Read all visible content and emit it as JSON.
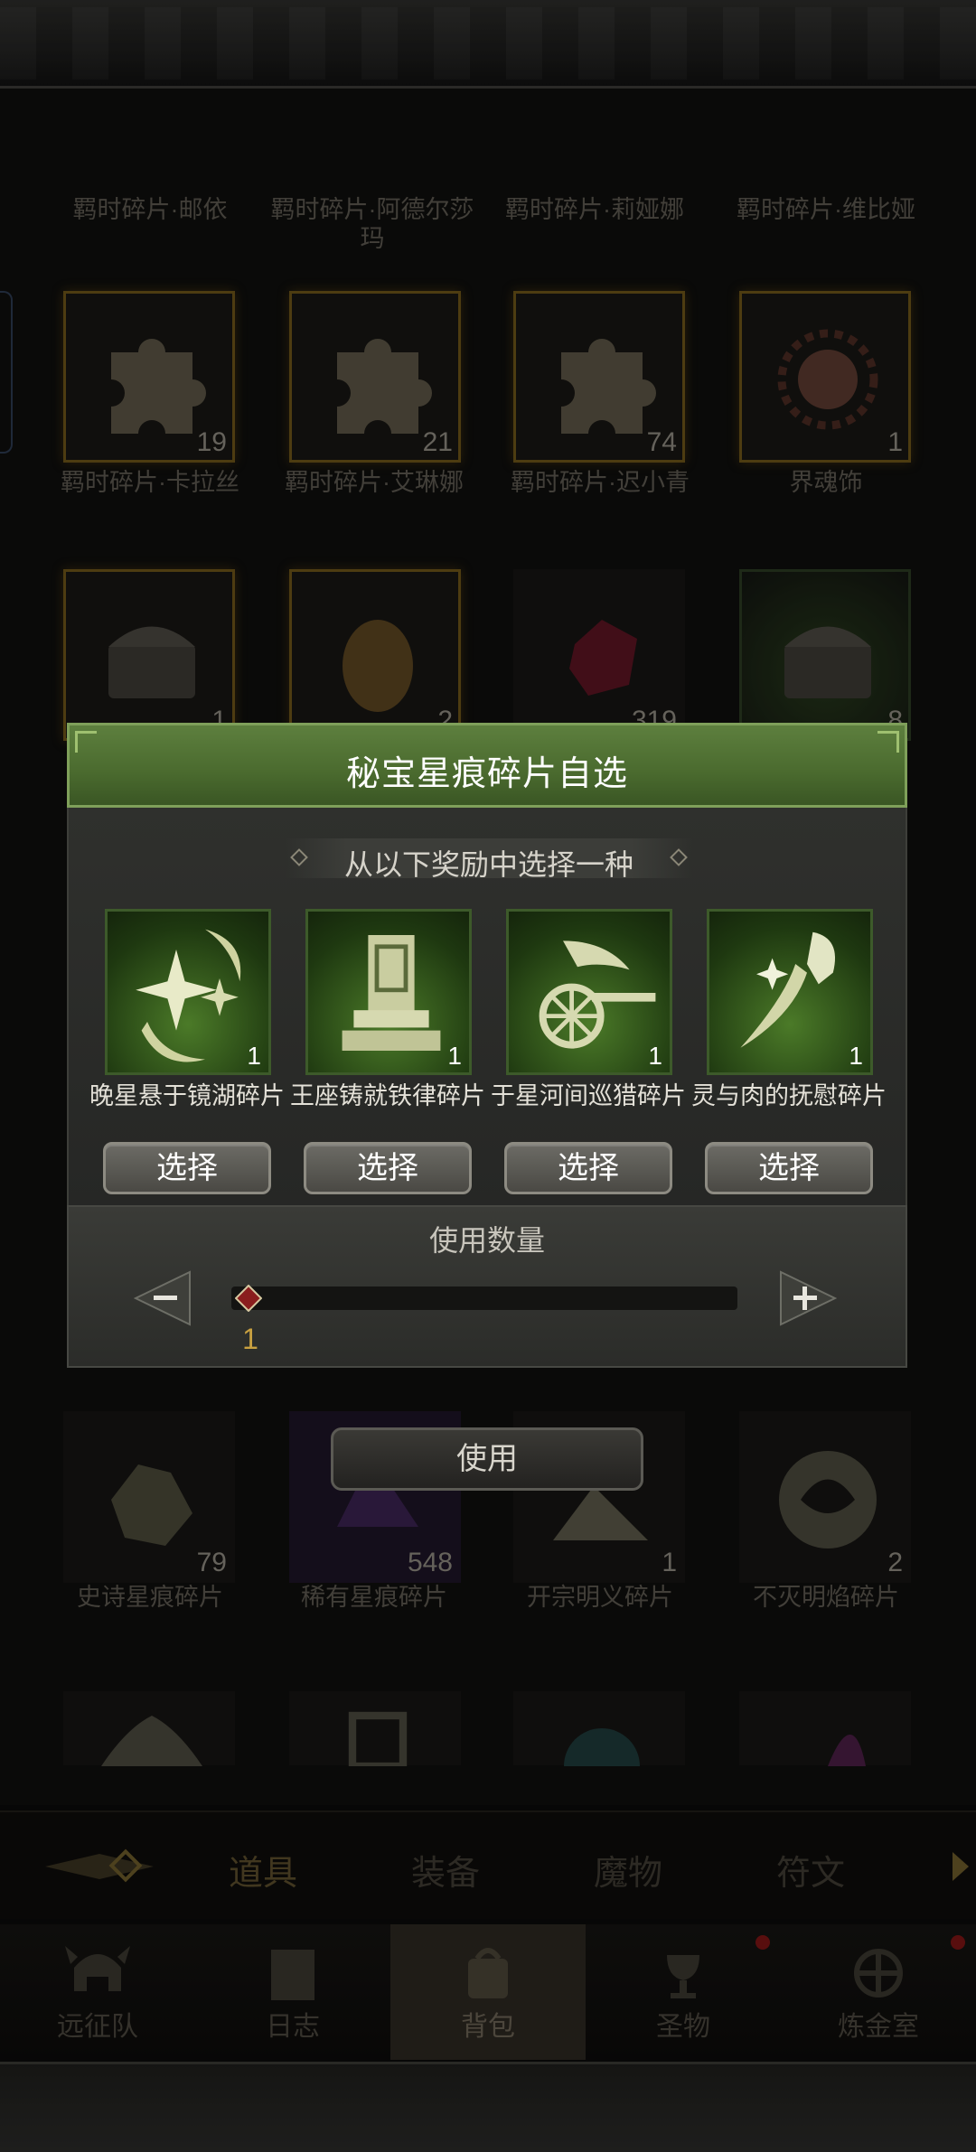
{
  "background": {
    "row0_labels": [
      "羁时碎片·邮依",
      "羁时碎片·阿德尔莎玛",
      "羁时碎片·莉娅娜",
      "羁时碎片·维比娅"
    ],
    "row1": [
      {
        "label": "羁时碎片·卡拉丝",
        "count": "19"
      },
      {
        "label": "羁时碎片·艾琳娜",
        "count": "21"
      },
      {
        "label": "羁时碎片·迟小青",
        "count": "74"
      },
      {
        "label": "界魂饰",
        "count": "1"
      }
    ],
    "row2_counts": [
      "1",
      "2",
      "319",
      "8"
    ],
    "row4": [
      {
        "label": "史诗星痕碎片",
        "count": "79"
      },
      {
        "label": "稀有星痕碎片",
        "count": "548"
      },
      {
        "label": "开宗明义碎片",
        "count": "1"
      },
      {
        "label": "不灭明焰碎片",
        "count": "2"
      }
    ]
  },
  "tabs": [
    "道具",
    "装备",
    "魔物",
    "符文"
  ],
  "bottom_nav": [
    {
      "label": "远征队",
      "icon": "helmet-icon",
      "dot": false
    },
    {
      "label": "日志",
      "icon": "scroll-icon",
      "dot": false
    },
    {
      "label": "背包",
      "icon": "backpack-icon",
      "dot": false,
      "active": true
    },
    {
      "label": "圣物",
      "icon": "chalice-icon",
      "dot": true
    },
    {
      "label": "炼金室",
      "icon": "alchemy-icon",
      "dot": true
    }
  ],
  "dialog": {
    "title": "秘宝星痕碎片自选",
    "subtitle": "从以下奖励中选择一种",
    "options": [
      {
        "name": "晚星悬于镜湖碎片",
        "qty": "1",
        "button": "选择",
        "icon": "star-moon-icon"
      },
      {
        "name": "王座铸就铁律碎片",
        "qty": "1",
        "button": "选择",
        "icon": "throne-icon"
      },
      {
        "name": "于星河间巡猎碎片",
        "qty": "1",
        "button": "选择",
        "icon": "chariot-icon"
      },
      {
        "name": "灵与肉的抚慰碎片",
        "qty": "1",
        "button": "选择",
        "icon": "hand-feather-icon"
      }
    ],
    "quantity_label": "使用数量",
    "quantity_value": "1",
    "use_button": "使用"
  },
  "colors": {
    "header_green": "#4a6a2e",
    "accent_gold": "#c8a040",
    "panel_dark": "#2b2c29"
  }
}
